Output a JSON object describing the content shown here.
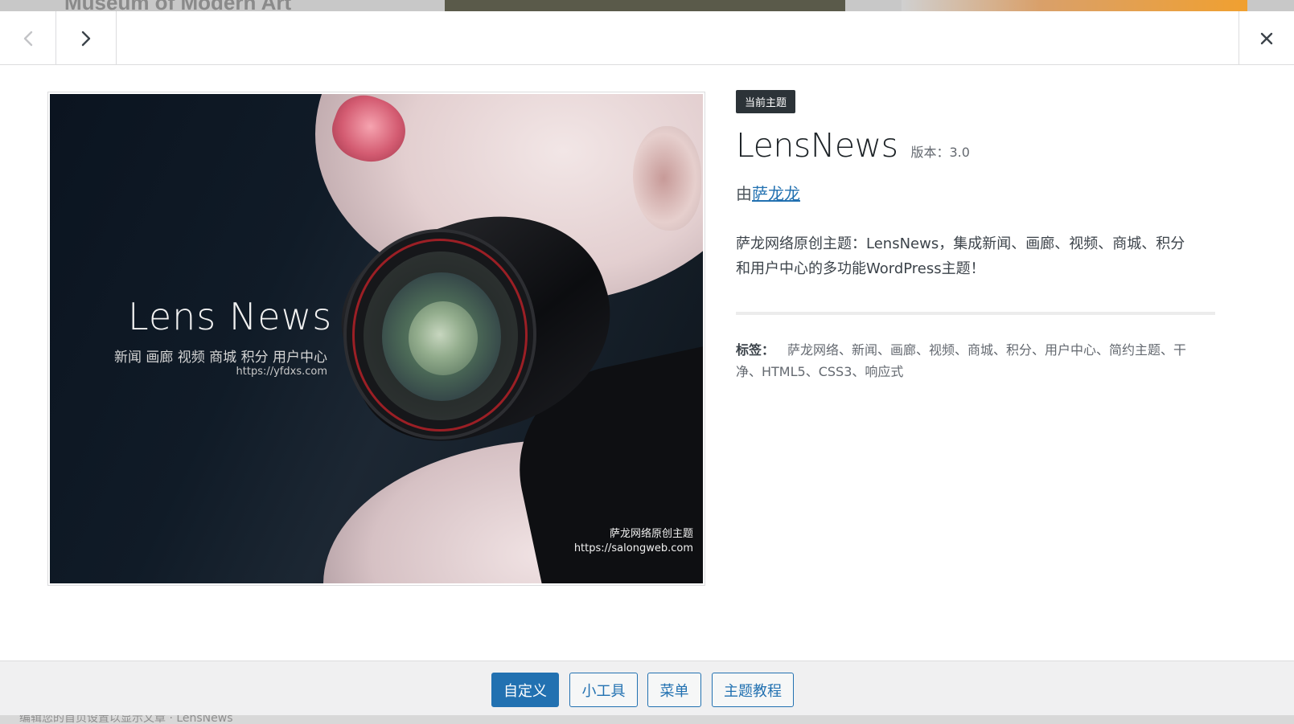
{
  "background": {
    "title": "Museum of Modern Art",
    "footer_text": "编辑您的首页设置以显示文章 · LensNews"
  },
  "topbar": {
    "prev_icon": "chevron-left-icon",
    "next_icon": "chevron-right-icon",
    "close_icon": "close-icon"
  },
  "screenshot": {
    "title": "Lens  News",
    "subtitle": "新闻 画廊 视频 商城 积分 用户中心",
    "url": "https://yfdxs.com",
    "brand": "萨龙网络原创主题",
    "brand_url": "https://salongweb.com"
  },
  "theme": {
    "badge": "当前主题",
    "name": "LensNews",
    "version": "版本：3.0",
    "author_prefix": "由",
    "author": "萨龙龙",
    "description": "萨龙网络原创主题：LensNews，集成新闻、画廊、视频、商城、积分和用户中心的多功能WordPress主题！",
    "tags_label": "标签：",
    "tags": "萨龙网络、新闻、画廊、视频、商城、积分、用户中心、简约主题、干净、HTML5、CSS3、响应式"
  },
  "footer": {
    "buttons": [
      "自定义",
      "小工具",
      "菜单",
      "主题教程"
    ]
  },
  "colors": {
    "primary": "#2271b1",
    "badge_bg": "#2c3338"
  }
}
